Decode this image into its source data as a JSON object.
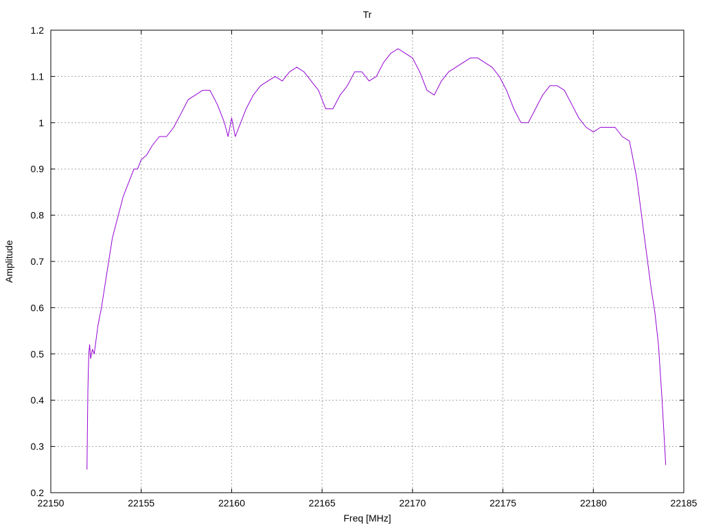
{
  "chart_data": {
    "type": "line",
    "title": "Tr",
    "xlabel": "Freq [MHz]",
    "ylabel": "Amplitude",
    "xlim": [
      22150,
      22185
    ],
    "ylim": [
      0.2,
      1.2
    ],
    "xticks": [
      22150,
      22155,
      22160,
      22165,
      22170,
      22175,
      22180,
      22185
    ],
    "yticks": [
      0.2,
      0.3,
      0.4,
      0.5,
      0.6,
      0.7,
      0.8,
      0.9,
      1,
      1.1,
      1.2
    ],
    "xtick_labels": [
      "22150",
      "22155",
      "22160",
      "22165",
      "22170",
      "22175",
      "22180",
      "22185"
    ],
    "ytick_labels": [
      "0.2",
      "0.3",
      "0.4",
      "0.5",
      "0.6",
      "0.7",
      "0.8",
      "0.9",
      "1",
      "1.1",
      "1.2"
    ],
    "grid": true,
    "legend": "none",
    "series": [
      {
        "color": "#9400d3",
        "x": [
          22152.0,
          22152.05,
          22152.1,
          22152.15,
          22152.2,
          22152.3,
          22152.4,
          22152.5,
          22152.6,
          22152.7,
          22152.8,
          22153.0,
          22153.2,
          22153.4,
          22153.6,
          22153.8,
          22154.0,
          22154.2,
          22154.4,
          22154.6,
          22154.8,
          22155.0,
          22155.3,
          22155.6,
          22156.0,
          22156.4,
          22156.8,
          22157.2,
          22157.6,
          22158.0,
          22158.4,
          22158.8,
          22159.2,
          22159.6,
          22159.8,
          22160.0,
          22160.2,
          22160.5,
          22160.8,
          22161.2,
          22161.6,
          22162.0,
          22162.4,
          22162.8,
          22163.2,
          22163.6,
          22164.0,
          22164.4,
          22164.8,
          22165.2,
          22165.6,
          22166.0,
          22166.4,
          22166.8,
          22167.2,
          22167.6,
          22168.0,
          22168.4,
          22168.8,
          22169.2,
          22169.6,
          22170.0,
          22170.4,
          22170.8,
          22171.2,
          22171.6,
          22172.0,
          22172.4,
          22172.8,
          22173.2,
          22173.6,
          22174.0,
          22174.4,
          22174.8,
          22175.2,
          22175.6,
          22176.0,
          22176.4,
          22176.8,
          22177.2,
          22177.6,
          22178.0,
          22178.4,
          22178.8,
          22179.2,
          22179.6,
          22180.0,
          22180.4,
          22180.8,
          22181.2,
          22181.6,
          22182.0,
          22182.4,
          22182.8,
          22183.0,
          22183.2,
          22183.4,
          22183.6,
          22183.8,
          22184.0
        ],
        "y": [
          0.25,
          0.42,
          0.5,
          0.52,
          0.49,
          0.51,
          0.5,
          0.53,
          0.56,
          0.58,
          0.6,
          0.65,
          0.7,
          0.75,
          0.78,
          0.81,
          0.84,
          0.86,
          0.88,
          0.9,
          0.9,
          0.92,
          0.93,
          0.95,
          0.97,
          0.97,
          0.99,
          1.02,
          1.05,
          1.06,
          1.07,
          1.07,
          1.04,
          1.0,
          0.97,
          1.01,
          0.97,
          1.0,
          1.03,
          1.06,
          1.08,
          1.09,
          1.1,
          1.09,
          1.11,
          1.12,
          1.11,
          1.09,
          1.07,
          1.03,
          1.03,
          1.06,
          1.08,
          1.11,
          1.11,
          1.09,
          1.1,
          1.13,
          1.15,
          1.16,
          1.15,
          1.14,
          1.11,
          1.07,
          1.06,
          1.09,
          1.11,
          1.12,
          1.13,
          1.14,
          1.14,
          1.13,
          1.12,
          1.1,
          1.07,
          1.03,
          1.0,
          1.0,
          1.03,
          1.06,
          1.08,
          1.08,
          1.07,
          1.04,
          1.01,
          0.99,
          0.98,
          0.99,
          0.99,
          0.99,
          0.97,
          0.96,
          0.88,
          0.76,
          0.7,
          0.64,
          0.59,
          0.52,
          0.4,
          0.26
        ]
      }
    ]
  }
}
